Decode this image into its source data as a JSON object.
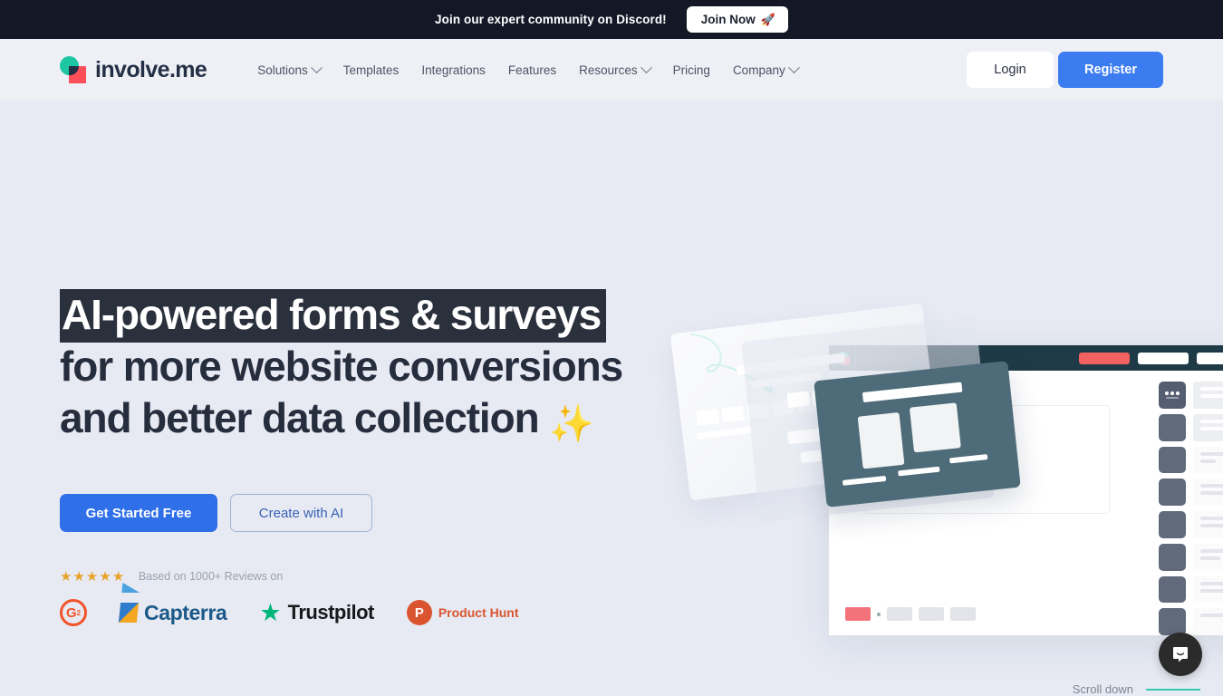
{
  "banner": {
    "text": "Join our expert community on Discord!",
    "button_label": "Join Now",
    "rocket_icon": "rocket-icon",
    "bg_color": "#141826"
  },
  "header": {
    "logo_text": "involve.me",
    "nav": [
      {
        "label": "Solutions",
        "has_dropdown": true
      },
      {
        "label": "Templates",
        "has_dropdown": false
      },
      {
        "label": "Integrations",
        "has_dropdown": false
      },
      {
        "label": "Features",
        "has_dropdown": false
      },
      {
        "label": "Resources",
        "has_dropdown": true
      },
      {
        "label": "Pricing",
        "has_dropdown": false
      },
      {
        "label": "Company",
        "has_dropdown": true
      }
    ],
    "login_label": "Login",
    "register_label": "Register",
    "register_color": "#3b7cf0"
  },
  "hero": {
    "headline_highlight": "AI-powered forms & surveys",
    "headline_line2": "for more website conversions",
    "headline_line3": "and better data collection",
    "sparkle_emoji": "✨",
    "cta_primary": "Get Started Free",
    "cta_secondary": "Create with AI",
    "primary_color": "#2f6fe8",
    "rating_stars": 4.5,
    "reviews_text": "Based on 1000+ Reviews on",
    "review_brands": [
      {
        "name": "G2",
        "label": "G2",
        "superscript": "2",
        "color": "#f2542a"
      },
      {
        "name": "Capterra",
        "label": "Capterra",
        "color": "#1b5988"
      },
      {
        "name": "Trustpilot",
        "label": "Trustpilot",
        "color": "#00b67a"
      },
      {
        "name": "Product Hunt",
        "label": "Product Hunt",
        "color": "#da552f"
      }
    ]
  },
  "footer_widgets": {
    "scroll_label": "Scroll down",
    "scroll_line_color": "#35c6b4",
    "chat_icon": "intercom-chat-icon"
  }
}
